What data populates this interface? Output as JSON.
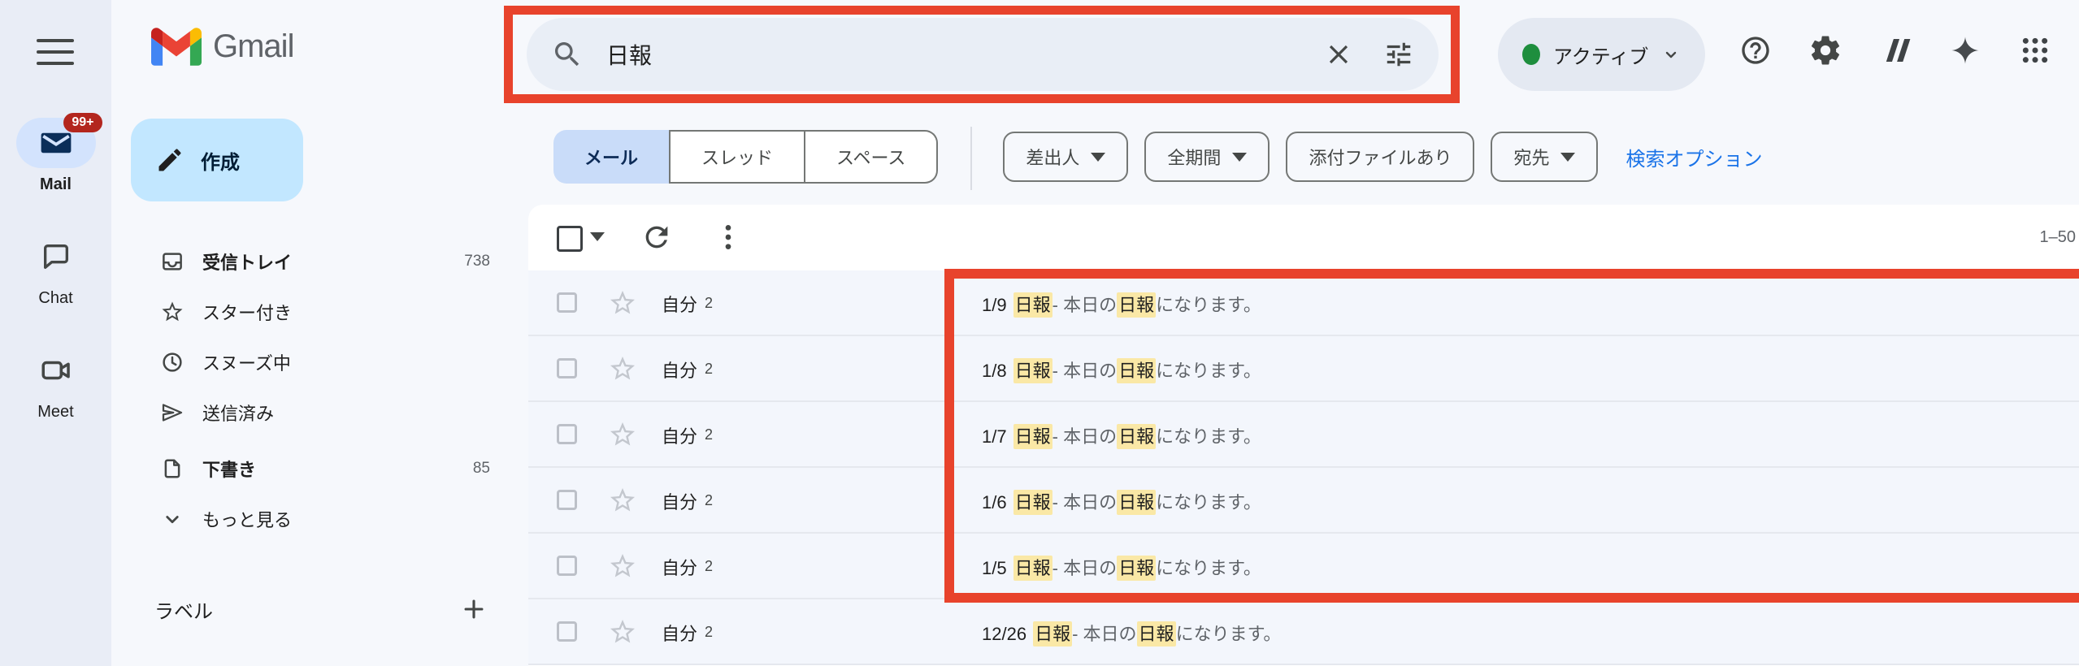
{
  "colors": {
    "annotation_red": "#e8432c",
    "highlight_yellow": "#fae8a6",
    "link_blue": "#1a73e8",
    "selected_tab_bg": "#c9dcf9",
    "compose_bg": "#c2e7ff",
    "badge_red": "#b3261e",
    "active_green": "#1e8e3e"
  },
  "header": {
    "logo_text": "Gmail",
    "search": {
      "query": "日報"
    },
    "status_chip": {
      "label": "アクティブ"
    }
  },
  "rail": {
    "items": [
      {
        "label": "Mail",
        "icon": "mail-icon",
        "badge": "99+",
        "active": true
      },
      {
        "label": "Chat",
        "icon": "chat-icon"
      },
      {
        "label": "Meet",
        "icon": "meet-icon"
      }
    ]
  },
  "sidebar": {
    "compose_label": "作成",
    "items": [
      {
        "label": "受信トレイ",
        "icon": "inbox-icon",
        "count": "738",
        "bold": true
      },
      {
        "label": "スター付き",
        "icon": "star-icon"
      },
      {
        "label": "スヌーズ中",
        "icon": "clock-icon"
      },
      {
        "label": "送信済み",
        "icon": "send-icon"
      },
      {
        "label": "下書き",
        "icon": "draft-icon",
        "count": "85",
        "bold": true
      },
      {
        "label": "もっと見る",
        "icon": "chevron-down-icon"
      }
    ],
    "labels_header": "ラベル"
  },
  "result_tabs": [
    {
      "label": "メール",
      "selected": true
    },
    {
      "label": "スレッド"
    },
    {
      "label": "スペース"
    }
  ],
  "filter_chips": [
    {
      "label": "差出人",
      "has_arrow": true
    },
    {
      "label": "全期間",
      "has_arrow": true
    },
    {
      "label": "添付ファイルあり",
      "has_arrow": false
    },
    {
      "label": "宛先",
      "has_arrow": true
    }
  ],
  "search_options_label": "検索オプション",
  "list": {
    "range_label": "1–50",
    "rows": [
      {
        "date": "1/9",
        "sender": "自分",
        "thread_count": "2",
        "keyword": "日報",
        "dash": " - ",
        "snippet_before": "本日の",
        "snippet_after": "になります。"
      },
      {
        "date": "1/8",
        "sender": "自分",
        "thread_count": "2",
        "keyword": "日報",
        "dash": " - ",
        "snippet_before": "本日の",
        "snippet_after": "になります。"
      },
      {
        "date": "1/7",
        "sender": "自分",
        "thread_count": "2",
        "keyword": "日報",
        "dash": " - ",
        "snippet_before": "本日の",
        "snippet_after": "になります。"
      },
      {
        "date": "1/6",
        "sender": "自分",
        "thread_count": "2",
        "keyword": "日報",
        "dash": " - ",
        "snippet_before": "本日の",
        "snippet_after": "になります。"
      },
      {
        "date": "1/5",
        "sender": "自分",
        "thread_count": "2",
        "keyword": "日報",
        "dash": " - ",
        "snippet_before": "本日の",
        "snippet_after": "になります。"
      },
      {
        "date": "12/26",
        "sender": "自分",
        "thread_count": "2",
        "keyword": "日報",
        "dash": " - ",
        "snippet_before": "本日の",
        "snippet_after": "になります。"
      }
    ]
  }
}
